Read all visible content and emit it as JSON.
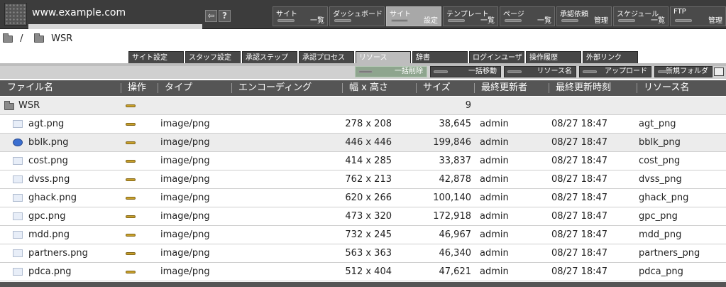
{
  "header": {
    "site_url": "www.example.com",
    "menu": [
      {
        "label1": "サイト",
        "label2": "一覧",
        "active": false
      },
      {
        "label1": "ダッシュボード",
        "label2": "",
        "active": false
      },
      {
        "label1": "サイト",
        "label2": "設定",
        "active": true
      },
      {
        "label1": "テンプレート",
        "label2": "一覧",
        "active": false
      },
      {
        "label1": "ページ",
        "label2": "一覧",
        "active": false
      },
      {
        "label1": "承認依頼",
        "label2": "管理",
        "active": false
      },
      {
        "label1": "スケジュール",
        "label2": "一覧",
        "active": false
      },
      {
        "label1": "FTP",
        "label2": "管理",
        "active": false
      }
    ],
    "help_glyph": "?",
    "back_glyph": "⇦"
  },
  "breadcrumb": {
    "root": "/",
    "current": "WSR"
  },
  "tabs": [
    {
      "label": "サイト設定",
      "active": false
    },
    {
      "label": "スタッフ設定",
      "active": false
    },
    {
      "label": "承認ステップ",
      "active": false
    },
    {
      "label": "承認プロセス",
      "active": false
    },
    {
      "label": "リソース",
      "active": true
    },
    {
      "label": "辞書",
      "active": false
    },
    {
      "label": "ログインユーザ",
      "active": false
    },
    {
      "label": "操作履歴",
      "active": false
    },
    {
      "label": "外部リンク",
      "active": false
    }
  ],
  "actions": [
    {
      "label": "一括削除",
      "highlight": true
    },
    {
      "label": "一括移動",
      "highlight": false
    },
    {
      "label": "リソース名",
      "highlight": false
    },
    {
      "label": "アップロード",
      "highlight": false
    },
    {
      "label": "新規フォルダ",
      "highlight": false
    }
  ],
  "table": {
    "columns": [
      "ファイル名",
      "操作",
      "タイプ",
      "エンコーディング",
      "幅 x 高さ",
      "サイズ",
      "最終更新者",
      "最終更新時刻",
      "リソース名"
    ],
    "folder_row": {
      "name": "WSR",
      "size": "9"
    },
    "rows": [
      {
        "name": "agt.png",
        "type": "image/png",
        "dims": "278 x 208",
        "size": "38,645",
        "user": "admin",
        "time": "08/27 18:47",
        "res": "agt_png",
        "thumb": "light"
      },
      {
        "name": "bblk.png",
        "type": "image/png",
        "dims": "446 x 446",
        "size": "199,846",
        "user": "admin",
        "time": "08/27 18:47",
        "res": "bblk_png",
        "thumb": "blue"
      },
      {
        "name": "cost.png",
        "type": "image/png",
        "dims": "414 x 285",
        "size": "33,837",
        "user": "admin",
        "time": "08/27 18:47",
        "res": "cost_png",
        "thumb": "light"
      },
      {
        "name": "dvss.png",
        "type": "image/png",
        "dims": "762 x 213",
        "size": "42,878",
        "user": "admin",
        "time": "08/27 18:47",
        "res": "dvss_png",
        "thumb": "light"
      },
      {
        "name": "ghack.png",
        "type": "image/png",
        "dims": "620 x 266",
        "size": "100,140",
        "user": "admin",
        "time": "08/27 18:47",
        "res": "ghack_png",
        "thumb": "light"
      },
      {
        "name": "gpc.png",
        "type": "image/png",
        "dims": "473 x 320",
        "size": "172,918",
        "user": "admin",
        "time": "08/27 18:47",
        "res": "gpc_png",
        "thumb": "light"
      },
      {
        "name": "mdd.png",
        "type": "image/png",
        "dims": "732 x 245",
        "size": "46,967",
        "user": "admin",
        "time": "08/27 18:47",
        "res": "mdd_png",
        "thumb": "light"
      },
      {
        "name": "partners.png",
        "type": "image/png",
        "dims": "563 x 363",
        "size": "46,340",
        "user": "admin",
        "time": "08/27 18:47",
        "res": "partners_png",
        "thumb": "light"
      },
      {
        "name": "pdca.png",
        "type": "image/png",
        "dims": "512 x 404",
        "size": "47,621",
        "user": "admin",
        "time": "08/27 18:47",
        "res": "pdca_png",
        "thumb": "light"
      }
    ]
  }
}
